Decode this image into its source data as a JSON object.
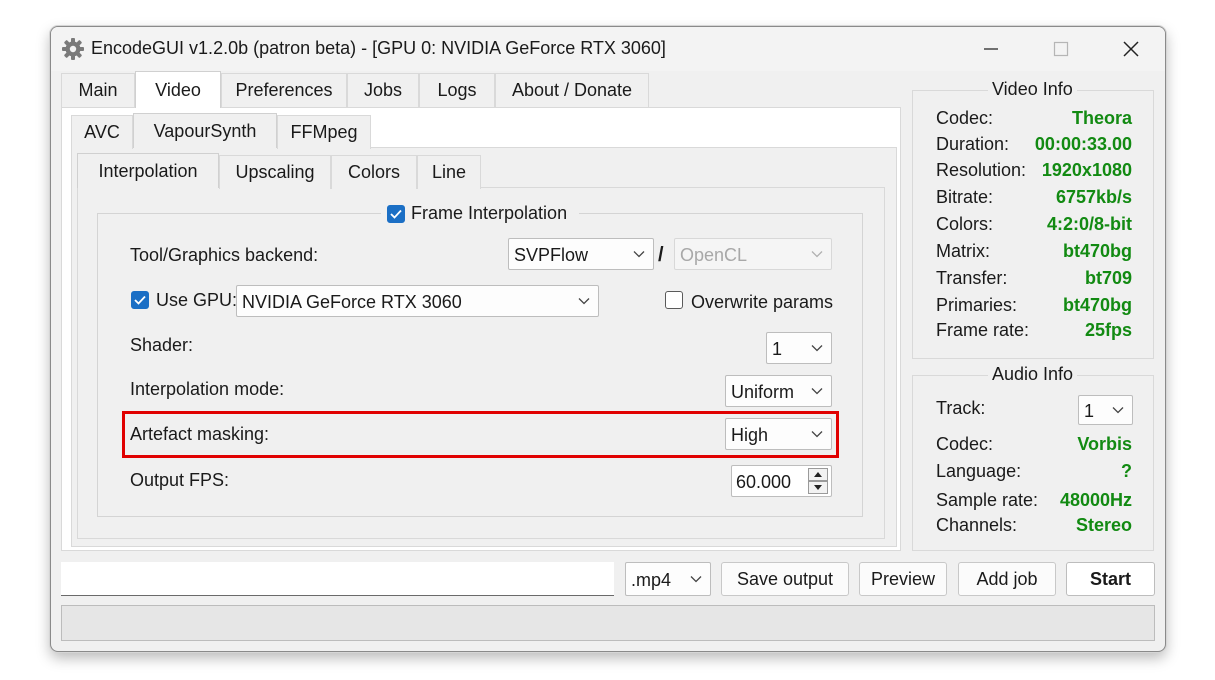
{
  "window": {
    "title": "EncodeGUI v1.2.0b (patron beta) - [GPU 0: NVIDIA GeForce RTX 3060]",
    "icons": {
      "app": "gear-icon",
      "minimize": "minimize-icon",
      "maximize": "maximize-icon",
      "close": "close-icon"
    }
  },
  "main_tabs": [
    "Main",
    "Video",
    "Preferences",
    "Jobs",
    "Logs",
    "About / Donate"
  ],
  "main_tabs_active": "Video",
  "video_tabs": [
    "AVC",
    "VapourSynth",
    "FFMpeg"
  ],
  "video_tabs_active": "VapourSynth",
  "vs_tabs": [
    "Interpolation",
    "Upscaling",
    "Colors",
    "Line"
  ],
  "vs_tabs_active": "Interpolation",
  "interpolation": {
    "group_label": "Frame Interpolation",
    "group_checked": true,
    "tool_label": "Tool/Graphics backend:",
    "tool_value": "SVPFlow",
    "separator": "/",
    "backend_value": "OpenCL",
    "use_gpu_label": "Use GPU:",
    "use_gpu_checked": true,
    "gpu_value": "NVIDIA GeForce RTX 3060",
    "overwrite_label": "Overwrite params",
    "overwrite_checked": false,
    "shader_label": "Shader:",
    "shader_value": "1",
    "mode_label": "Interpolation mode:",
    "mode_value": "Uniform",
    "masking_label": "Artefact masking:",
    "masking_value": "High",
    "fps_label": "Output FPS:",
    "fps_value": "60.000"
  },
  "video_info": {
    "title": "Video Info",
    "rows": [
      {
        "k": "Codec:",
        "v": "Theora"
      },
      {
        "k": "Duration:",
        "v": "00:00:33.00"
      },
      {
        "k": "Resolution:",
        "v": "1920x1080"
      },
      {
        "k": "Bitrate:",
        "v": "6757kb/s"
      },
      {
        "k": "Colors:",
        "v": "4:2:0/8-bit"
      },
      {
        "k": "Matrix:",
        "v": "bt470bg"
      },
      {
        "k": "Transfer:",
        "v": "bt709"
      },
      {
        "k": "Primaries:",
        "v": "bt470bg"
      },
      {
        "k": "Frame rate:",
        "v": "25fps"
      }
    ]
  },
  "audio_info": {
    "title": "Audio Info",
    "track_label": "Track:",
    "track_value": "1",
    "rows": [
      {
        "k": "Codec:",
        "v": "Vorbis"
      },
      {
        "k": "Language:",
        "v": "?"
      },
      {
        "k": "Sample rate:",
        "v": "48000Hz"
      },
      {
        "k": "Channels:",
        "v": "Stereo"
      }
    ]
  },
  "bottom": {
    "output_path": "",
    "extension": ".mp4",
    "save_output": "Save output",
    "preview": "Preview",
    "add_job": "Add job",
    "start": "Start"
  },
  "colors": {
    "accent": "#1b6fc5",
    "value_green": "#128a12",
    "highlight_red": "#e00000"
  }
}
